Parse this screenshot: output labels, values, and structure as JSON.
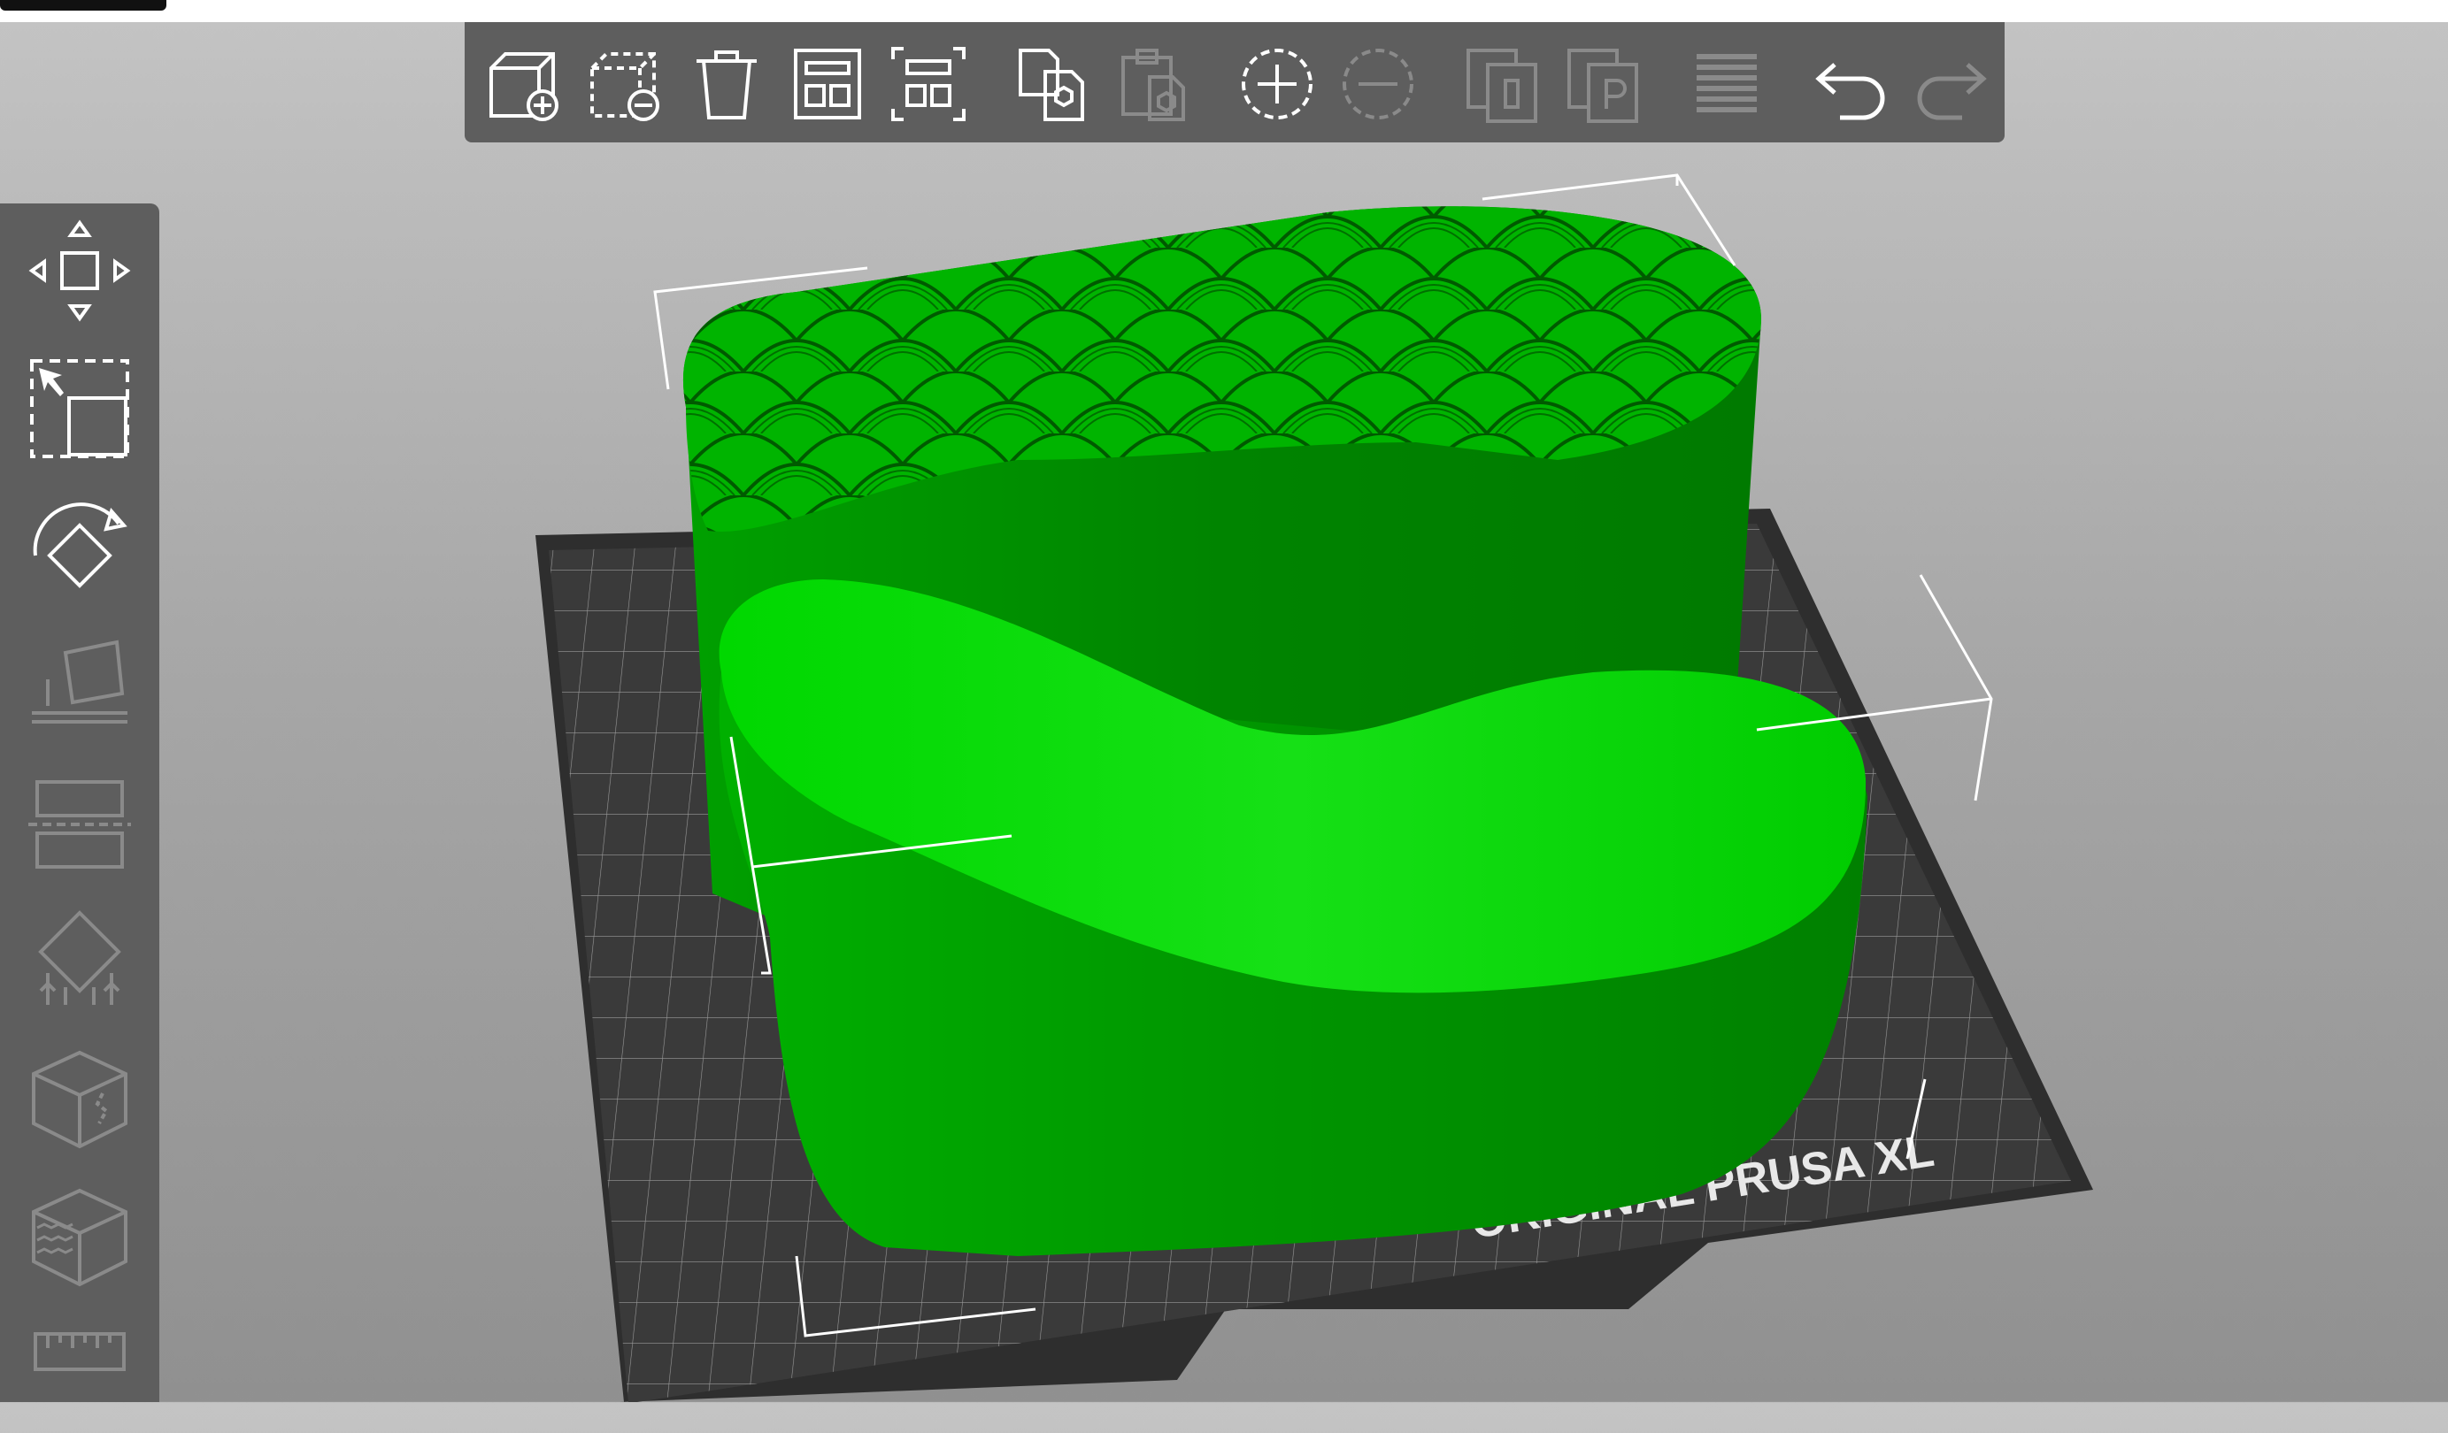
{
  "window": {
    "title": ""
  },
  "toolbar": {
    "buttons": [
      {
        "name": "add-object-button",
        "icon": "cube-plus-icon",
        "enabled": true
      },
      {
        "name": "delete-button",
        "icon": "cube-minus-icon",
        "enabled": true
      },
      {
        "name": "delete-all-button",
        "icon": "trash-icon",
        "enabled": true
      },
      {
        "name": "arrange-button",
        "icon": "arrange-icon",
        "enabled": true
      },
      {
        "name": "arrange-selection-button",
        "icon": "arrange-selection-icon",
        "enabled": true
      },
      {
        "name": "copy-button",
        "icon": "copy-icon",
        "enabled": true
      },
      {
        "name": "paste-button",
        "icon": "paste-icon",
        "enabled": false
      },
      {
        "name": "add-instance-button",
        "icon": "plus-circle-icon",
        "enabled": true
      },
      {
        "name": "remove-instance-button",
        "icon": "minus-circle-icon",
        "enabled": false
      },
      {
        "name": "split-objects-button",
        "icon": "split-objects-icon",
        "enabled": false
      },
      {
        "name": "split-parts-button",
        "icon": "split-parts-icon",
        "enabled": false
      },
      {
        "name": "layers-button",
        "icon": "layers-icon",
        "enabled": false
      },
      {
        "name": "undo-button",
        "icon": "undo-icon",
        "enabled": true
      },
      {
        "name": "redo-button",
        "icon": "redo-icon",
        "enabled": false
      }
    ]
  },
  "sidebar": {
    "tools": [
      {
        "name": "move-tool",
        "icon": "move-icon",
        "enabled": true
      },
      {
        "name": "scale-tool",
        "icon": "scale-icon",
        "enabled": true
      },
      {
        "name": "rotate-tool",
        "icon": "rotate-icon",
        "enabled": true
      },
      {
        "name": "place-on-face-tool",
        "icon": "place-on-face-icon",
        "enabled": false
      },
      {
        "name": "cut-tool",
        "icon": "cut-icon",
        "enabled": false
      },
      {
        "name": "support-tool",
        "icon": "support-icon",
        "enabled": false
      },
      {
        "name": "seam-tool",
        "icon": "seam-icon",
        "enabled": false
      },
      {
        "name": "fuzzy-skin-tool",
        "icon": "fuzzy-skin-icon",
        "enabled": false
      },
      {
        "name": "measure-tool",
        "icon": "ruler-icon",
        "enabled": false
      }
    ]
  },
  "bed": {
    "label": "ORIGINAL PRUSA XL"
  },
  "colors": {
    "panel": "#5e5e5e",
    "icon_active": "#ffffff",
    "icon_disabled": "#8a8a8a",
    "model_top": "#00c800",
    "model_side": "#008c00",
    "bed": "#2e2e2e"
  }
}
